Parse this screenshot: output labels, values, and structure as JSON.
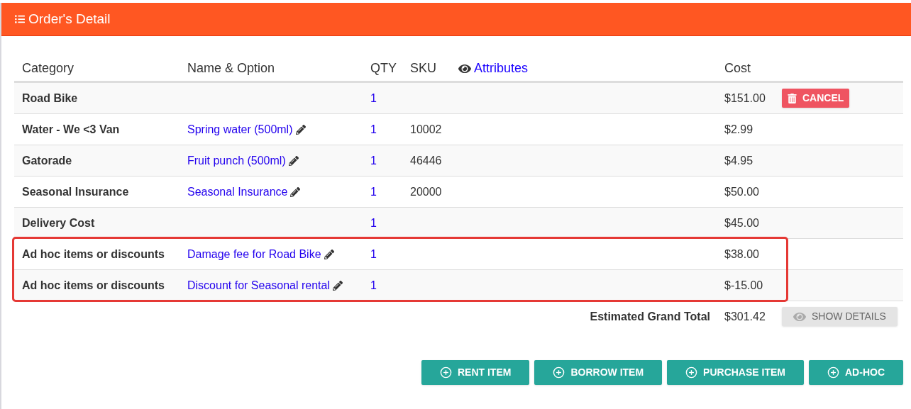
{
  "panel": {
    "title": "Order's Detail"
  },
  "table": {
    "columns": [
      "Category",
      "Name & Option",
      "QTY",
      "SKU",
      "Attributes",
      "Cost"
    ],
    "rows": [
      {
        "category": "Road Bike",
        "qty": "1",
        "cost": "$151.00",
        "action": "CANCEL",
        "highlighted": false
      },
      {
        "category": "Water - We <3 Van",
        "name": "Spring water (500ml)",
        "qty": "1",
        "sku": "10002",
        "cost": "$2.99",
        "highlighted": false
      },
      {
        "category": "Gatorade",
        "name": "Fruit punch (500ml)",
        "qty": "1",
        "sku": "46446",
        "cost": "$4.95",
        "highlighted": false
      },
      {
        "category": "Seasonal Insurance",
        "name": "Seasonal Insurance",
        "qty": "1",
        "sku": "20000",
        "cost": "$50.00",
        "highlighted": false
      },
      {
        "category": "Delivery Cost",
        "qty": "1",
        "cost": "$45.00",
        "highlighted": false
      },
      {
        "category": "Ad hoc items or discounts",
        "name": "Damage fee for Road Bike",
        "qty": "1",
        "cost": "$38.00",
        "highlighted": true
      },
      {
        "category": "Ad hoc items or discounts",
        "name": "Discount for Seasonal rental",
        "qty": "1",
        "cost": "$-15.00",
        "highlighted": true
      }
    ]
  },
  "total": {
    "label": "Estimated Grand Total",
    "value": "$301.42",
    "button": "SHOW DETAILS"
  },
  "actions": [
    "RENT ITEM",
    "BORROW ITEM",
    "PURCHASE ITEM",
    "AD-HOC"
  ]
}
